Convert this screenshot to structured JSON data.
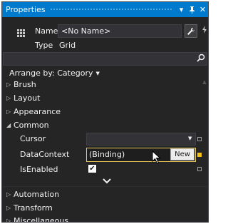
{
  "window": {
    "title": "Properties",
    "dropdown_icon": "chevron-down-icon",
    "pin_icon": "pin-icon",
    "close_icon": "close-icon"
  },
  "header": {
    "name_label": "Name",
    "name_value": "<No Name>",
    "type_label": "Type",
    "type_value": "Grid",
    "wrench_icon": "wrench-icon",
    "events_icon": "lightning-icon"
  },
  "search": {
    "value": "",
    "icon": "search-icon"
  },
  "arrange": {
    "label": "Arrange by: Category"
  },
  "categories_top": [
    {
      "label": "Brush",
      "expanded": false
    },
    {
      "label": "Layout",
      "expanded": false
    },
    {
      "label": "Appearance",
      "expanded": false
    }
  ],
  "common": {
    "label": "Common",
    "expanded": true,
    "cursor": {
      "label": "Cursor",
      "value": ""
    },
    "datacontext": {
      "label": "DataContext",
      "value": "(Binding)",
      "button": "New"
    },
    "isenabled": {
      "label": "IsEnabled",
      "checked": true,
      "check_glyph": "✔"
    }
  },
  "categories_bottom": [
    {
      "label": "Automation",
      "expanded": false
    },
    {
      "label": "Transform",
      "expanded": false
    },
    {
      "label": "Miscellaneous",
      "expanded": false
    }
  ],
  "colors": {
    "title_bar": "#007acc",
    "panel_bg": "#252526",
    "binding_border": "#e8c85a",
    "set_marker": "#f5c211"
  }
}
